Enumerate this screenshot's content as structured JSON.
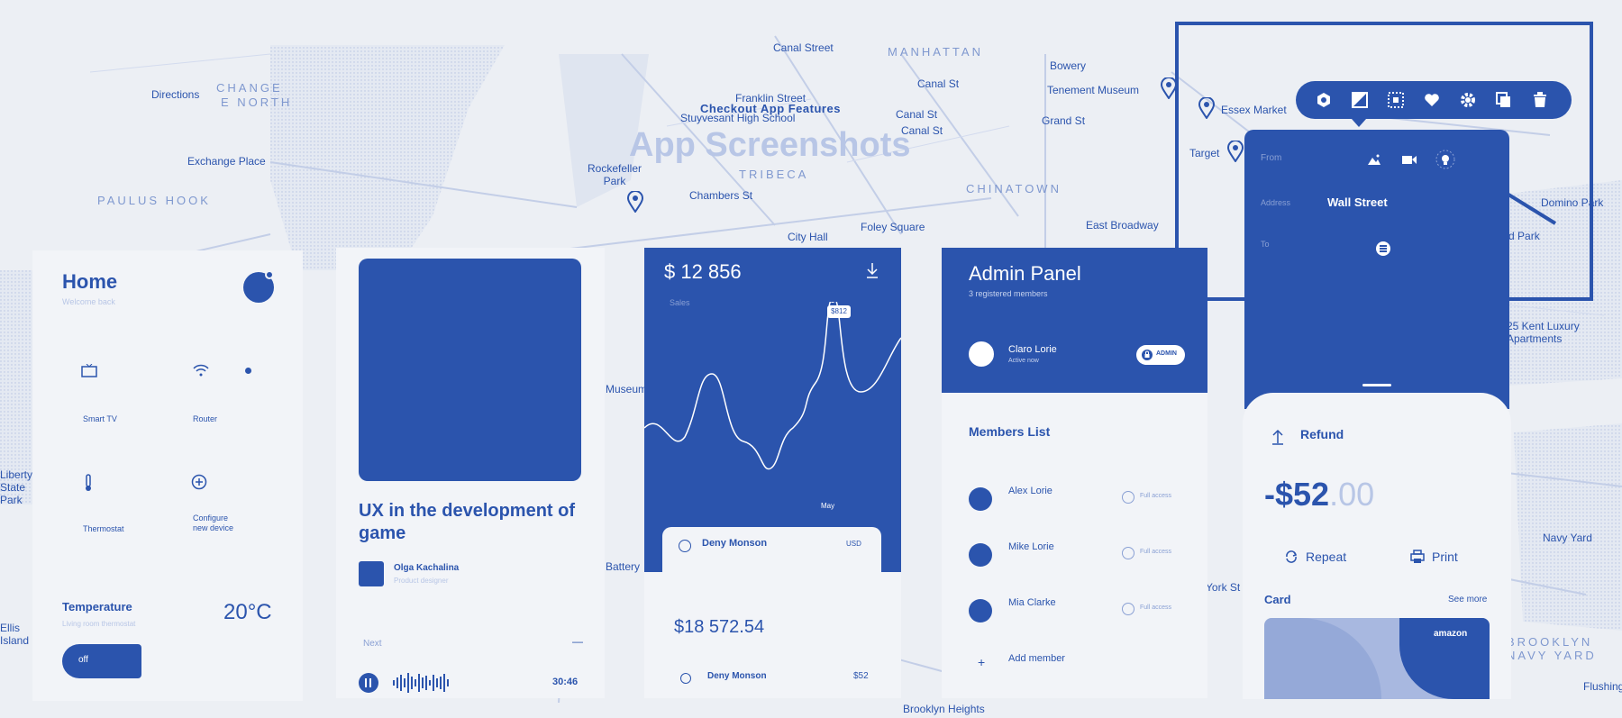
{
  "colors": {
    "brand": "#2b54ad",
    "background": "#eceff4",
    "card": "#f2f4f8",
    "muted": "#8aa0d4"
  },
  "map": {
    "title": "App Screenshots",
    "subtitle": "Checkout App Features",
    "labels": [
      "Canal Street",
      "MANHATTAN",
      "Bowery",
      "Directions",
      "CHANGE",
      "E NORTH",
      "Franklin Street",
      "Stuyvesant High School",
      "Canal St",
      "Tenement Museum",
      "Canal St",
      "Canal St",
      "Grand St",
      "Exchange Place",
      "Rockefeller Park",
      "TRIBECA",
      "CHINATOWN",
      "PAULUS HOOK",
      "Chambers St",
      "Foley Square",
      "East Broadway",
      "City Hall",
      "Essex Market",
      "Target",
      "Domino Park",
      "Seward Park",
      "25 Kent Luxury Apartments",
      "Navy Yard",
      "BROOKLYN NAVY YARD",
      "Brooklyn Heights",
      "Liberty State Park",
      "Ellis Island",
      "Museum",
      "Battery",
      "York St",
      "Flushing"
    ]
  },
  "toolbar": {
    "icons": [
      "hexagon-icon",
      "contrast-icon",
      "dotted-square-icon",
      "heart-icon",
      "gear-icon",
      "copy-icon",
      "trash-icon"
    ]
  },
  "home": {
    "title": "Home",
    "subtitle": "Welcome back",
    "devices": [
      {
        "icon": "tv-icon",
        "label": "Smart TV"
      },
      {
        "icon": "wifi-icon",
        "label": "Router"
      },
      {
        "icon": "thermometer-icon",
        "label": "Thermostat"
      },
      {
        "icon": "add-icon",
        "label": "Configure\nnew device"
      }
    ],
    "temperature_label": "Temperature",
    "temperature_sub": "Living room thermostat",
    "temperature_value": "20°C",
    "toggle_label": "off"
  },
  "article": {
    "title": "UX in the development of game",
    "author": "Olga Kachalina",
    "author_sub": "Product designer",
    "audio_label": "Next",
    "audio_time": "30:46"
  },
  "finance": {
    "balance": "$ 12 856",
    "chart_label": "Sales",
    "tooltip": "$812",
    "month_label": "May",
    "card_name": "Deny Monson",
    "card_currency": "USD",
    "amount": "$18 572.54",
    "row_name": "Deny Monson",
    "row_value": "$52"
  },
  "admin": {
    "title": "Admin Panel",
    "subtitle": "3 registered members",
    "owner_name": "Claro Lorie",
    "owner_sub": "Active now",
    "owner_badge": "ADMIN",
    "members_title": "Members List",
    "members": [
      {
        "name": "Alex Lorie",
        "access": "Full access"
      },
      {
        "name": "Mike Lorie",
        "access": "Full access"
      },
      {
        "name": "Mia Clarke",
        "access": "Full access"
      }
    ],
    "add_label": "Add member"
  },
  "route": {
    "from_label": "From",
    "address_label": "Address",
    "address_value": "Wall Street",
    "to_label": "To"
  },
  "refund": {
    "title": "Refund",
    "amount_main": "-$52",
    "amount_cents": ".00",
    "repeat_label": "Repeat",
    "print_label": "Print",
    "card_label": "Card",
    "see_more": "See more",
    "brand": "amazon"
  }
}
